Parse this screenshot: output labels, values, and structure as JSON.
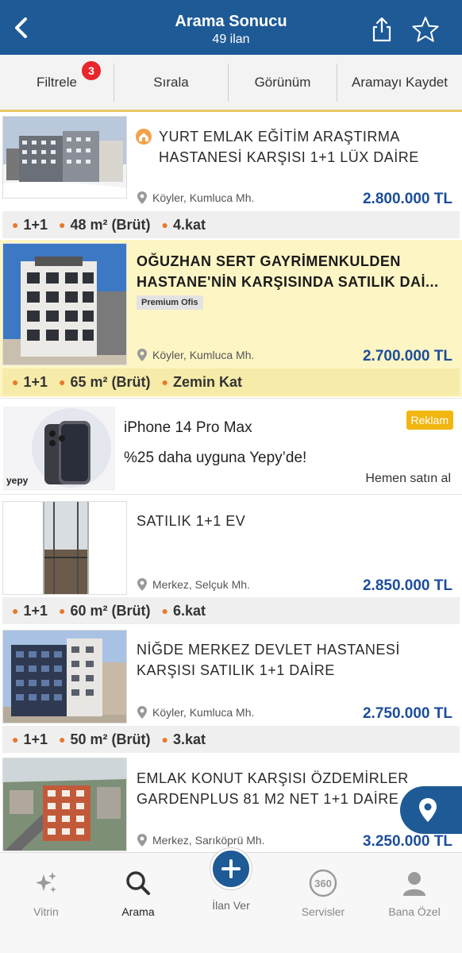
{
  "header": {
    "title": "Arama Sonucu",
    "subtitle": "49 ilan"
  },
  "toolbar": {
    "filter_label": "Filtrele",
    "filter_badge": "3",
    "sort_label": "Sırala",
    "view_label": "Görünüm",
    "save_label": "Aramayı Kaydet"
  },
  "listings": [
    {
      "title": "YURT EMLAK EĞİTİM ARAŞTIRMA HASTANESİ KARŞISI 1+1 LÜX DAİRE",
      "location": "Köyler, Kumluca Mh.",
      "price": "2.800.000 TL",
      "attrs": [
        "1+1",
        "48 m² (Brüt)",
        "4.kat"
      ]
    },
    {
      "title": "OĞUZHAN SERT GAYRİMENKULDEN HASTANE'NİN KARŞISINDA SATILIK DAİ...",
      "tag": "Premium Ofis",
      "location": "Köyler, Kumluca Mh.",
      "price": "2.700.000 TL",
      "attrs": [
        "1+1",
        "65 m² (Brüt)",
        "Zemin Kat"
      ]
    },
    {
      "title": "SATILIK 1+1 EV",
      "location": "Merkez, Selçuk Mh.",
      "price": "2.850.000 TL",
      "attrs": [
        "1+1",
        "60 m² (Brüt)",
        "6.kat"
      ]
    },
    {
      "title": "NİĞDE MERKEZ DEVLET HASTANESİ KARŞISI SATILIK 1+1 DAİRE",
      "location": "Köyler, Kumluca Mh.",
      "price": "2.750.000 TL",
      "attrs": [
        "1+1",
        "50 m² (Brüt)",
        "3.kat"
      ]
    },
    {
      "title": "EMLAK KONUT KARŞISI ÖZDEMİRLER GARDENPLUS 81 M2 NET 1+1 DAİRE",
      "location": "Merkez, Sarıköprü Mh.",
      "price": "3.250.000 TL"
    }
  ],
  "ad": {
    "title": "iPhone 14 Pro Max",
    "description": "%25 daha uyguna Yepy’de!",
    "cta": "Hemen satın al",
    "label": "Reklam",
    "brand": "yepy"
  },
  "bottom_nav": {
    "items": [
      {
        "label": "Vitrin",
        "icon": "sparkle-icon"
      },
      {
        "label": "Arama",
        "icon": "search-icon"
      },
      {
        "label": "İlan Ver",
        "icon": "plus-icon"
      },
      {
        "label": "Servisler",
        "icon": "360-icon"
      },
      {
        "label": "Bana Özel",
        "icon": "user-icon"
      }
    ]
  },
  "colors": {
    "primary": "#1e5a96",
    "price": "#1c4e9a",
    "premium_bg": "#fdf5c4",
    "badge": "#e8262b",
    "reklam": "#f2b611",
    "accent_dot": "#e8782a"
  }
}
